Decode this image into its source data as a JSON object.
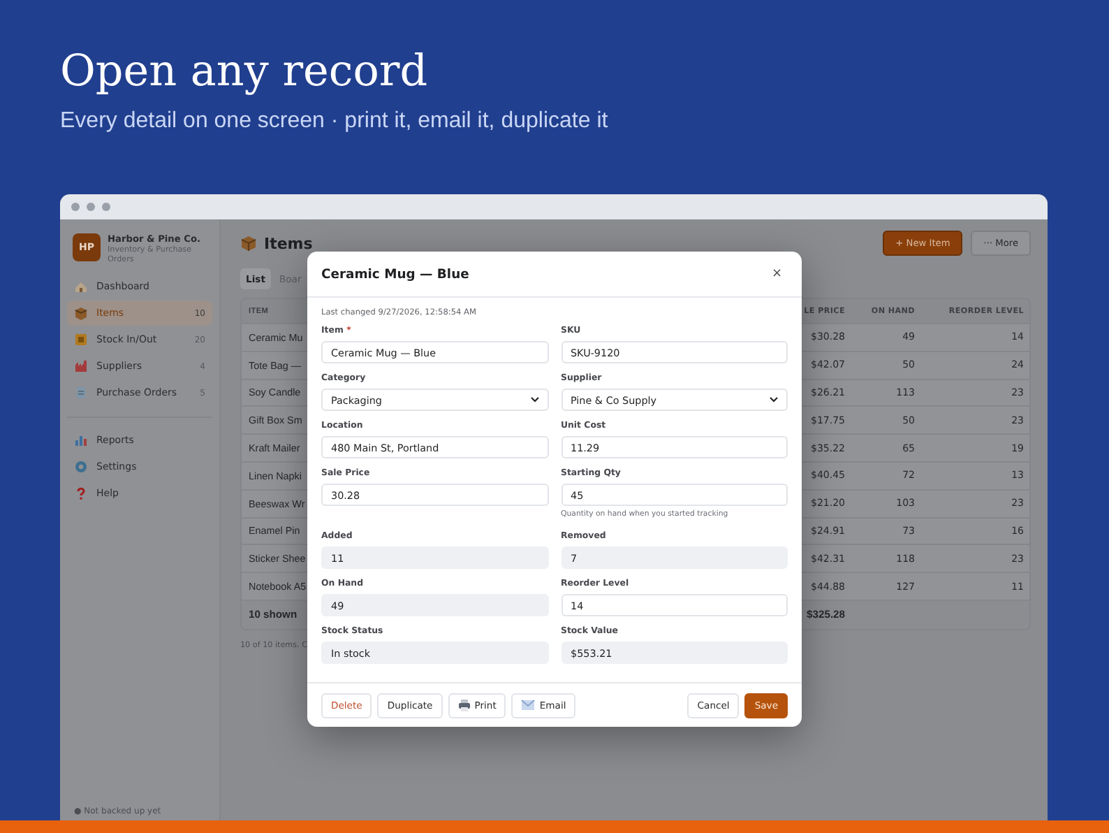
{
  "hero": {
    "title": "Open any record",
    "subtitle": "Every detail on one screen · print it, email it, duplicate it"
  },
  "sidebar": {
    "avatar": "HP",
    "brand": "Harbor & Pine Co.",
    "tagline": "Inventory & Purchase Orders",
    "nav_groups": [
      {
        "items": [
          {
            "label": "Dashboard",
            "selected": false
          },
          {
            "label": "Items",
            "count": "10",
            "selected": true
          },
          {
            "label": "Stock In/Out",
            "count": "20",
            "selected": false
          },
          {
            "label": "Suppliers",
            "count": "4",
            "selected": false
          },
          {
            "label": "Purchase Orders",
            "count": "5",
            "selected": false
          }
        ]
      },
      {
        "items": [
          {
            "label": "Reports",
            "selected": false
          },
          {
            "label": "Settings",
            "selected": false
          },
          {
            "label": "Help",
            "selected": false
          }
        ]
      }
    ],
    "footer": "● Not backed up yet"
  },
  "main": {
    "title": "Items",
    "buttons": [
      {
        "label": "+ New Item",
        "kind": "primary"
      },
      {
        "label": "··· More",
        "kind": "secondary"
      }
    ],
    "tabs": [
      {
        "label": "List",
        "selected": true
      },
      {
        "label": "Boar",
        "selected": false
      }
    ],
    "table": {
      "columns": [
        "ITEM",
        "LE PRICE",
        "ON HAND",
        "REORDER LEVEL"
      ],
      "rows": [
        [
          "Ceramic Mu",
          "$30.28",
          "49",
          "14"
        ],
        [
          "Tote Bag —",
          "$42.07",
          "50",
          "24"
        ],
        [
          "Soy Candle",
          "$26.21",
          "113",
          "23"
        ],
        [
          "Gift Box Sm",
          "$17.75",
          "50",
          "23"
        ],
        [
          "Kraft Mailer",
          "$35.22",
          "65",
          "19"
        ],
        [
          "Linen Napki",
          "$40.45",
          "72",
          "13"
        ],
        [
          "Beeswax Wr",
          "$21.20",
          "103",
          "23"
        ],
        [
          "Enamel Pin",
          "$24.91",
          "73",
          "16"
        ],
        [
          "Sticker Shee",
          "$42.31",
          "118",
          "23"
        ],
        [
          "Notebook A5",
          "$44.88",
          "127",
          "11"
        ]
      ],
      "footer": [
        "10 shown",
        "$325.28"
      ]
    },
    "note": "10 of 10 items. C"
  },
  "dialog": {
    "title": "Ceramic Mug — Blue",
    "close": "×",
    "changed": "Last changed 9/27/2026, 12:58:54 AM",
    "fields": [
      {
        "label": "Item",
        "mark": "*",
        "value": "Ceramic Mug — Blue",
        "kind": "text"
      },
      {
        "label": "SKU",
        "value": "SKU-9120",
        "kind": "text"
      },
      {
        "label": "Category",
        "value": "Packaging",
        "kind": "select"
      },
      {
        "label": "Supplier",
        "value": "Pine & Co Supply",
        "kind": "select"
      },
      {
        "label": "Location",
        "value": "480 Main St, Portland",
        "kind": "text"
      },
      {
        "label": "Unit Cost",
        "value": "11.29",
        "kind": "text"
      },
      {
        "label": "Sale Price",
        "value": "30.28",
        "kind": "text"
      },
      {
        "label": "Starting Qty",
        "value": "45",
        "kind": "text",
        "hint": "Quantity on hand when you started tracking"
      },
      {
        "label": "Added",
        "value": "11",
        "kind": "readonly"
      },
      {
        "label": "Removed",
        "value": "7",
        "kind": "readonly"
      },
      {
        "label": "On Hand",
        "value": "49",
        "kind": "readonly"
      },
      {
        "label": "Reorder Level",
        "value": "14",
        "kind": "text"
      },
      {
        "label": "Stock Status",
        "value": "In stock",
        "kind": "readonly"
      },
      {
        "label": "Stock Value",
        "value": "$553.21",
        "kind": "readonly"
      }
    ],
    "left_buttons": [
      {
        "label": "Delete",
        "kind": "danger"
      },
      {
        "label": "Duplicate",
        "kind": "plain"
      },
      {
        "label": "Print",
        "kind": "print"
      },
      {
        "label": "Email",
        "kind": "email"
      }
    ],
    "right_buttons": [
      {
        "label": "Cancel",
        "kind": "plain"
      },
      {
        "label": "Save",
        "kind": "primary"
      }
    ]
  }
}
